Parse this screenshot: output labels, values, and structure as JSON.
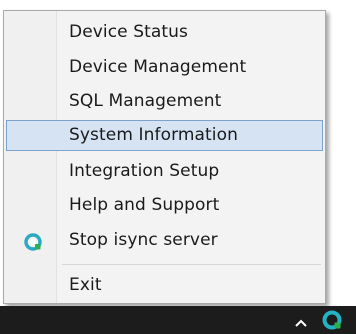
{
  "menu": {
    "items": [
      {
        "label": "Device Status",
        "selected": false
      },
      {
        "label": "Device Management",
        "selected": false
      },
      {
        "label": "SQL Management",
        "selected": false
      },
      {
        "label": "System Information",
        "selected": true
      },
      {
        "label": "Integration Setup",
        "selected": false
      },
      {
        "label": "Help and Support",
        "selected": false
      },
      {
        "label": "Stop isync server",
        "selected": false,
        "icon": "isync-server-icon"
      }
    ],
    "exit_label": "Exit",
    "highlight_color": "#d5e3f3",
    "highlight_border_color": "#7da2ce"
  },
  "taskbar": {
    "icons": [
      "chevron-up-icon",
      "isync-tray-icon"
    ],
    "background_color": "#1c1c1c",
    "sync_icon_color": "#24b3c4"
  }
}
